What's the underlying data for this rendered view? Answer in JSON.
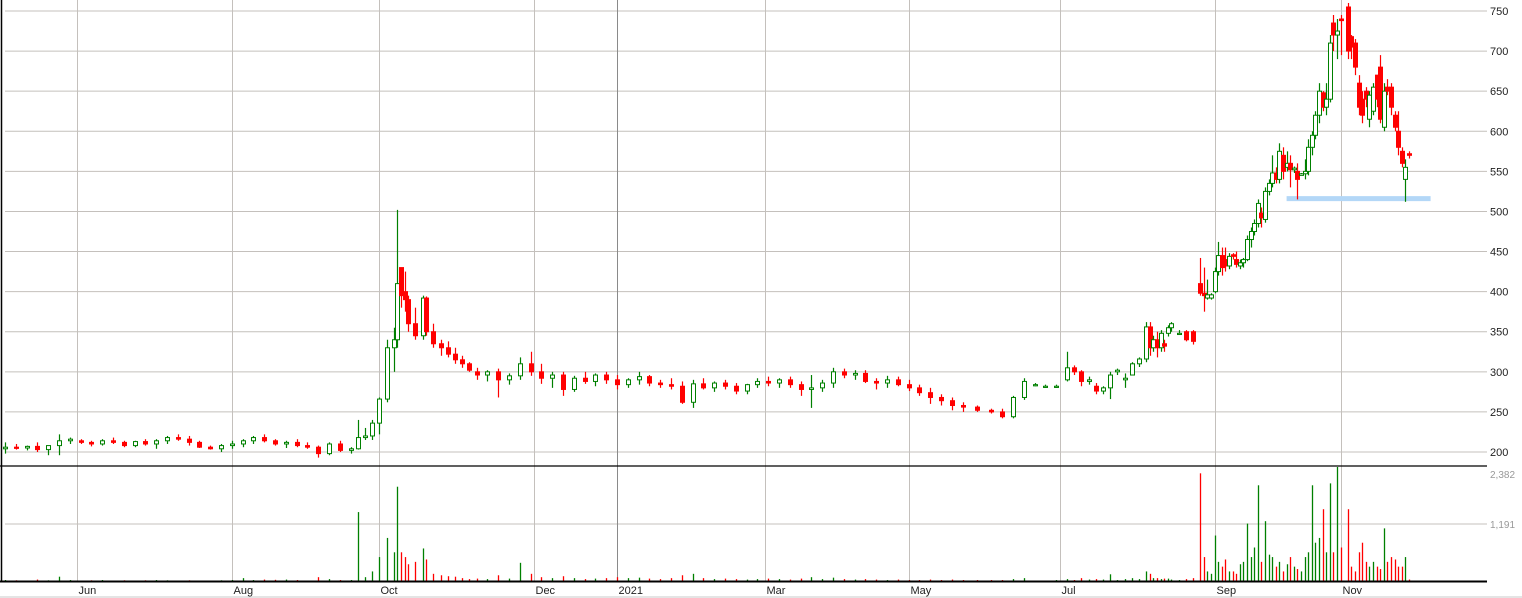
{
  "chart_data": {
    "type": "candlestick",
    "title": "",
    "price_axis": {
      "ticks": [
        200,
        250,
        300,
        350,
        400,
        450,
        500,
        550,
        600,
        650,
        700,
        750
      ],
      "ylim": [
        200,
        750
      ],
      "side": "right"
    },
    "volume_axis": {
      "tick_labels": [
        "2,382",
        "1,191"
      ],
      "ticks": [
        2382,
        1191
      ],
      "ylim": [
        0,
        2382
      ]
    },
    "x_axis": {
      "unit": "trading day index",
      "xlim": [
        0,
        391
      ],
      "months": [
        {
          "label": "Jun",
          "day": 20
        },
        {
          "label": "Aug",
          "day": 63
        },
        {
          "label": "Oct",
          "day": 104
        },
        {
          "label": "Dec",
          "day": 147
        },
        {
          "label": "2021",
          "day": 170,
          "year_start": true
        },
        {
          "label": "Mar",
          "day": 211
        },
        {
          "label": "May",
          "day": 251
        },
        {
          "label": "Jul",
          "day": 293
        },
        {
          "label": "Sep",
          "day": 336
        },
        {
          "label": "Nov",
          "day": 371
        }
      ]
    },
    "colors": {
      "up": "#008000",
      "down": "#ff0000",
      "grid": "#c4c0bc",
      "support": "#b3d7f7"
    },
    "support_line": {
      "price": 516,
      "from_day": 356,
      "to_day": 396
    },
    "candle_fields": [
      "day",
      "open",
      "high",
      "low",
      "close",
      "volume"
    ],
    "candles": [
      [
        0,
        204,
        212,
        198,
        206,
        20
      ],
      [
        3,
        206,
        210,
        203,
        205,
        15
      ],
      [
        6,
        205,
        208,
        202,
        207,
        10
      ],
      [
        9,
        207,
        212,
        200,
        203,
        30
      ],
      [
        12,
        203,
        208,
        196,
        208,
        15
      ],
      [
        15,
        208,
        222,
        196,
        214,
        90
      ],
      [
        18,
        214,
        218,
        210,
        216,
        20
      ],
      [
        21,
        214,
        216,
        210,
        212,
        10
      ],
      [
        24,
        212,
        214,
        207,
        210,
        15
      ],
      [
        27,
        210,
        216,
        208,
        214,
        20
      ],
      [
        30,
        214,
        218,
        210,
        212,
        10
      ],
      [
        33,
        212,
        214,
        206,
        208,
        15
      ],
      [
        36,
        208,
        214,
        206,
        213,
        10
      ],
      [
        39,
        213,
        216,
        208,
        210,
        15
      ],
      [
        42,
        210,
        216,
        204,
        214,
        20
      ],
      [
        45,
        214,
        220,
        210,
        218,
        15
      ],
      [
        48,
        218,
        222,
        214,
        216,
        10
      ],
      [
        51,
        216,
        220,
        208,
        212,
        15
      ],
      [
        54,
        212,
        214,
        205,
        206,
        10
      ],
      [
        57,
        206,
        208,
        203,
        204,
        10
      ],
      [
        60,
        204,
        210,
        200,
        208,
        15
      ],
      [
        63,
        208,
        214,
        204,
        210,
        20
      ],
      [
        66,
        210,
        216,
        206,
        214,
        60
      ],
      [
        69,
        214,
        220,
        210,
        218,
        20
      ],
      [
        72,
        218,
        222,
        212,
        214,
        30
      ],
      [
        75,
        214,
        216,
        208,
        210,
        25
      ],
      [
        78,
        210,
        214,
        205,
        212,
        30
      ],
      [
        81,
        212,
        216,
        206,
        208,
        20
      ],
      [
        84,
        208,
        212,
        204,
        206,
        10
      ],
      [
        87,
        206,
        208,
        193,
        198,
        80
      ],
      [
        90,
        198,
        212,
        196,
        210,
        40
      ],
      [
        93,
        210,
        214,
        200,
        202,
        20
      ],
      [
        96,
        202,
        206,
        198,
        204,
        20
      ],
      [
        98,
        204,
        240,
        203,
        218,
        1440
      ],
      [
        100,
        218,
        230,
        215,
        220,
        80
      ],
      [
        102,
        220,
        240,
        215,
        236,
        200
      ],
      [
        104,
        236,
        268,
        222,
        266,
        500
      ],
      [
        106,
        266,
        340,
        262,
        330,
        900
      ],
      [
        108,
        330,
        355,
        300,
        340,
        600
      ],
      [
        109,
        340,
        502,
        330,
        410,
        1970
      ],
      [
        110,
        430,
        430,
        380,
        395,
        600
      ],
      [
        111,
        400,
        425,
        375,
        390,
        500
      ],
      [
        112,
        390,
        395,
        350,
        360,
        350
      ],
      [
        114,
        360,
        380,
        340,
        345,
        400
      ],
      [
        116,
        345,
        395,
        340,
        392,
        680
      ],
      [
        117,
        392,
        394,
        345,
        350,
        450
      ],
      [
        119,
        350,
        360,
        330,
        335,
        150
      ],
      [
        121,
        335,
        340,
        320,
        330,
        120
      ],
      [
        123,
        330,
        338,
        318,
        322,
        100
      ],
      [
        125,
        322,
        330,
        310,
        315,
        90
      ],
      [
        127,
        315,
        320,
        305,
        310,
        60
      ],
      [
        129,
        310,
        312,
        300,
        302,
        40
      ],
      [
        131,
        300,
        305,
        290,
        296,
        50
      ],
      [
        134,
        296,
        302,
        288,
        300,
        40
      ],
      [
        137,
        300,
        304,
        268,
        290,
        120
      ],
      [
        140,
        290,
        298,
        284,
        295,
        50
      ],
      [
        143,
        295,
        318,
        290,
        310,
        380
      ],
      [
        146,
        310,
        325,
        295,
        300,
        150
      ],
      [
        149,
        300,
        310,
        285,
        292,
        80
      ],
      [
        152,
        292,
        300,
        280,
        296,
        60
      ],
      [
        155,
        296,
        300,
        270,
        278,
        100
      ],
      [
        158,
        278,
        295,
        275,
        292,
        60
      ],
      [
        161,
        292,
        300,
        285,
        288,
        40
      ],
      [
        164,
        288,
        298,
        282,
        296,
        50
      ],
      [
        167,
        296,
        300,
        285,
        290,
        60
      ],
      [
        170,
        290,
        296,
        278,
        284,
        80
      ],
      [
        173,
        284,
        292,
        280,
        290,
        60
      ],
      [
        176,
        290,
        300,
        284,
        294,
        70
      ],
      [
        179,
        294,
        296,
        282,
        286,
        50
      ],
      [
        182,
        286,
        290,
        280,
        284,
        40
      ],
      [
        185,
        284,
        292,
        278,
        282,
        60
      ],
      [
        188,
        282,
        288,
        260,
        262,
        120
      ],
      [
        191,
        262,
        290,
        255,
        285,
        150
      ],
      [
        194,
        285,
        292,
        278,
        280,
        60
      ],
      [
        197,
        280,
        288,
        275,
        286,
        40
      ],
      [
        200,
        286,
        290,
        278,
        282,
        50
      ],
      [
        203,
        282,
        286,
        272,
        276,
        40
      ],
      [
        206,
        276,
        285,
        272,
        284,
        30
      ],
      [
        209,
        284,
        292,
        280,
        288,
        40
      ],
      [
        212,
        288,
        294,
        282,
        286,
        50
      ],
      [
        215,
        286,
        292,
        280,
        290,
        40
      ],
      [
        218,
        290,
        294,
        280,
        284,
        30
      ],
      [
        221,
        284,
        288,
        270,
        278,
        50
      ],
      [
        224,
        278,
        296,
        255,
        280,
        80
      ],
      [
        227,
        280,
        290,
        275,
        286,
        40
      ],
      [
        230,
        286,
        305,
        280,
        300,
        70
      ],
      [
        233,
        300,
        304,
        292,
        296,
        40
      ],
      [
        236,
        296,
        302,
        290,
        298,
        30
      ],
      [
        239,
        298,
        302,
        286,
        288,
        40
      ],
      [
        242,
        288,
        292,
        278,
        286,
        30
      ],
      [
        245,
        286,
        295,
        280,
        290,
        20
      ],
      [
        248,
        290,
        294,
        282,
        284,
        30
      ],
      [
        251,
        284,
        290,
        276,
        280,
        20
      ],
      [
        254,
        280,
        284,
        270,
        274,
        20
      ],
      [
        257,
        274,
        280,
        260,
        268,
        30
      ],
      [
        260,
        268,
        272,
        258,
        264,
        20
      ],
      [
        263,
        264,
        268,
        252,
        258,
        30
      ],
      [
        266,
        258,
        262,
        250,
        256,
        20
      ],
      [
        270,
        256,
        258,
        250,
        252,
        20
      ],
      [
        274,
        252,
        254,
        248,
        250,
        20
      ],
      [
        277,
        250,
        254,
        242,
        244,
        20
      ],
      [
        280,
        244,
        270,
        242,
        268,
        40
      ],
      [
        283,
        268,
        292,
        265,
        288,
        60
      ],
      [
        286,
        284,
        286,
        282,
        284,
        10
      ],
      [
        289,
        282,
        284,
        280,
        282,
        10
      ],
      [
        292,
        282,
        284,
        280,
        282,
        20
      ],
      [
        295,
        290,
        325,
        288,
        305,
        40
      ],
      [
        297,
        305,
        308,
        296,
        300,
        20
      ],
      [
        299,
        300,
        302,
        282,
        288,
        60
      ],
      [
        301,
        288,
        294,
        284,
        290,
        30
      ],
      [
        303,
        282,
        286,
        272,
        276,
        40
      ],
      [
        305,
        276,
        282,
        272,
        280,
        30
      ],
      [
        307,
        280,
        300,
        266,
        296,
        140
      ],
      [
        309,
        300,
        304,
        296,
        302,
        20
      ],
      [
        311,
        290,
        298,
        280,
        292,
        40
      ],
      [
        313,
        296,
        312,
        296,
        310,
        60
      ],
      [
        315,
        310,
        318,
        306,
        316,
        40
      ],
      [
        317,
        316,
        362,
        312,
        356,
        200
      ],
      [
        318,
        356,
        362,
        320,
        330,
        150
      ],
      [
        319,
        330,
        345,
        325,
        340,
        60
      ],
      [
        320,
        340,
        350,
        318,
        330,
        60
      ],
      [
        321,
        330,
        352,
        325,
        348,
        40
      ],
      [
        322,
        335,
        340,
        325,
        332,
        50
      ],
      [
        323,
        348,
        358,
        344,
        355,
        50
      ],
      [
        324,
        355,
        362,
        350,
        360,
        30
      ],
      [
        326,
        348,
        352,
        346,
        348,
        20
      ],
      [
        328,
        350,
        352,
        338,
        340,
        40
      ],
      [
        330,
        350,
        352,
        334,
        338,
        60
      ],
      [
        332,
        410,
        442,
        395,
        398,
        2250
      ],
      [
        333,
        398,
        430,
        375,
        395,
        500
      ],
      [
        334,
        392,
        415,
        390,
        396,
        200
      ],
      [
        335,
        392,
        398,
        390,
        396,
        150
      ],
      [
        336,
        400,
        430,
        398,
        425,
        950
      ],
      [
        337,
        425,
        462,
        420,
        445,
        400
      ],
      [
        338,
        445,
        455,
        420,
        430,
        300
      ],
      [
        339,
        440,
        455,
        425,
        432,
        450
      ],
      [
        340,
        432,
        448,
        428,
        444,
        200
      ],
      [
        341,
        446,
        448,
        440,
        444,
        200
      ],
      [
        342,
        440,
        450,
        430,
        434,
        150
      ],
      [
        343,
        432,
        440,
        428,
        436,
        350
      ],
      [
        344,
        436,
        442,
        430,
        440,
        400
      ],
      [
        345,
        440,
        470,
        438,
        465,
        1200
      ],
      [
        346,
        465,
        480,
        455,
        475,
        500
      ],
      [
        347,
        475,
        490,
        470,
        485,
        700
      ],
      [
        348,
        485,
        515,
        480,
        510,
        2000
      ],
      [
        349,
        498,
        505,
        480,
        492,
        400
      ],
      [
        350,
        490,
        530,
        486,
        525,
        1250
      ],
      [
        351,
        525,
        540,
        520,
        535,
        550
      ],
      [
        352,
        535,
        570,
        530,
        548,
        500
      ],
      [
        353,
        548,
        555,
        535,
        540,
        300
      ],
      [
        354,
        540,
        585,
        535,
        575,
        400
      ],
      [
        355,
        570,
        580,
        540,
        550,
        200
      ],
      [
        356,
        555,
        575,
        550,
        560,
        350
      ],
      [
        357,
        560,
        570,
        530,
        552,
        500
      ],
      [
        358,
        552,
        556,
        548,
        554,
        300
      ],
      [
        359,
        550,
        560,
        515,
        540,
        250
      ],
      [
        360,
        545,
        548,
        545,
        547,
        200
      ],
      [
        361,
        547,
        565,
        540,
        550,
        500
      ],
      [
        362,
        550,
        590,
        545,
        580,
        600
      ],
      [
        363,
        580,
        600,
        570,
        595,
        2000
      ],
      [
        364,
        595,
        625,
        590,
        620,
        800
      ],
      [
        365,
        620,
        660,
        610,
        650,
        900
      ],
      [
        366,
        648,
        650,
        625,
        630,
        1500
      ],
      [
        367,
        630,
        660,
        620,
        640,
        600
      ],
      [
        368,
        640,
        720,
        636,
        710,
        2040
      ],
      [
        369,
        735,
        745,
        700,
        720,
        600
      ],
      [
        370,
        720,
        740,
        690,
        725,
        2382
      ],
      [
        371,
        740,
        745,
        695,
        738,
        700
      ],
      [
        373,
        755,
        760,
        690,
        700,
        1500
      ],
      [
        374,
        718,
        720,
        690,
        705,
        300
      ],
      [
        375,
        710,
        715,
        670,
        680,
        200
      ],
      [
        376,
        660,
        670,
        620,
        630,
        600
      ],
      [
        377,
        640,
        650,
        610,
        620,
        800
      ],
      [
        378,
        650,
        655,
        630,
        640,
        400
      ],
      [
        379,
        615,
        650,
        605,
        645,
        300
      ],
      [
        380,
        625,
        660,
        620,
        655,
        400
      ],
      [
        381,
        670,
        670,
        630,
        640,
        300
      ],
      [
        382,
        680,
        695,
        610,
        615,
        250
      ],
      [
        383,
        605,
        660,
        600,
        650,
        1100
      ],
      [
        384,
        655,
        665,
        645,
        650,
        400
      ],
      [
        385,
        655,
        660,
        620,
        630,
        500
      ],
      [
        386,
        620,
        625,
        600,
        605,
        450
      ],
      [
        387,
        600,
        625,
        570,
        580,
        300
      ],
      [
        388,
        575,
        580,
        555,
        560,
        300
      ],
      [
        389,
        540,
        565,
        512,
        555,
        500
      ],
      [
        390,
        572,
        575,
        566,
        570,
        30
      ]
    ]
  }
}
